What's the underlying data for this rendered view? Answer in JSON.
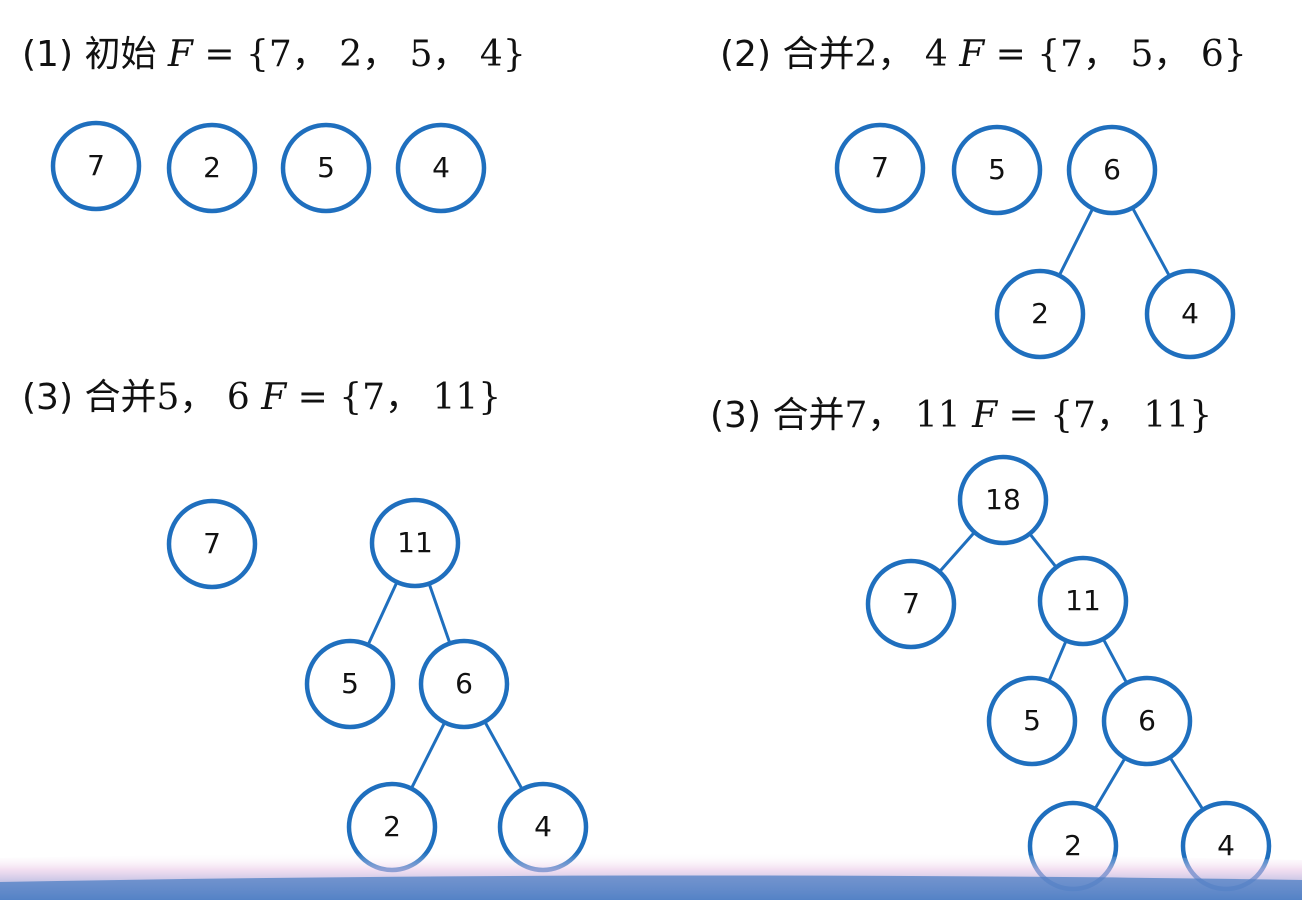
{
  "panels": [
    {
      "caption": {
        "number": "(1)",
        "verb": "初始",
        "pair": "",
        "set_label": "F",
        "set_value": "= {7， 2， 5， 4}"
      },
      "nodes": [
        {
          "id": "p1-7",
          "label": "7"
        },
        {
          "id": "p1-2",
          "label": "2"
        },
        {
          "id": "p1-5",
          "label": "5"
        },
        {
          "id": "p1-4",
          "label": "4"
        }
      ],
      "edges": []
    },
    {
      "caption": {
        "number": "(2)",
        "verb": "合并",
        "pair": "2， 4",
        "set_label": "F",
        "set_value": "= {7， 5， 6}"
      },
      "nodes": [
        {
          "id": "p2-7",
          "label": "7"
        },
        {
          "id": "p2-5",
          "label": "5"
        },
        {
          "id": "p2-6",
          "label": "6"
        },
        {
          "id": "p2-2",
          "label": "2"
        },
        {
          "id": "p2-4",
          "label": "4"
        }
      ],
      "edges": [
        [
          "p2-6",
          "p2-2"
        ],
        [
          "p2-6",
          "p2-4"
        ]
      ]
    },
    {
      "caption": {
        "number": "(3)",
        "verb": "合并",
        "pair": "5， 6",
        "set_label": "F",
        "set_value": "= {7， 11}"
      },
      "nodes": [
        {
          "id": "p3-7",
          "label": "7"
        },
        {
          "id": "p3-11",
          "label": "11"
        },
        {
          "id": "p3-5",
          "label": "5"
        },
        {
          "id": "p3-6",
          "label": "6"
        },
        {
          "id": "p3-2",
          "label": "2"
        },
        {
          "id": "p3-4",
          "label": "4"
        }
      ],
      "edges": [
        [
          "p3-11",
          "p3-5"
        ],
        [
          "p3-11",
          "p3-6"
        ],
        [
          "p3-6",
          "p3-2"
        ],
        [
          "p3-6",
          "p3-4"
        ]
      ]
    },
    {
      "caption": {
        "number": "(3)",
        "verb": "合并",
        "pair": "7， 11",
        "set_label": "F",
        "set_value": "= {7， 11}"
      },
      "nodes": [
        {
          "id": "p4-18",
          "label": "18"
        },
        {
          "id": "p4-7",
          "label": "7"
        },
        {
          "id": "p4-11",
          "label": "11"
        },
        {
          "id": "p4-5",
          "label": "5"
        },
        {
          "id": "p4-6",
          "label": "6"
        },
        {
          "id": "p4-2",
          "label": "2"
        },
        {
          "id": "p4-4",
          "label": "4"
        }
      ],
      "edges": [
        [
          "p4-18",
          "p4-7"
        ],
        [
          "p4-18",
          "p4-11"
        ],
        [
          "p4-11",
          "p4-5"
        ],
        [
          "p4-11",
          "p4-6"
        ],
        [
          "p4-6",
          "p4-2"
        ],
        [
          "p4-6",
          "p4-4"
        ]
      ]
    }
  ],
  "colors": {
    "node_stroke": "#1f6fbe",
    "edge": "#1f6fbe",
    "text": "#111111",
    "band": "#5b86c7",
    "band_accent": "#e9c6e6"
  }
}
